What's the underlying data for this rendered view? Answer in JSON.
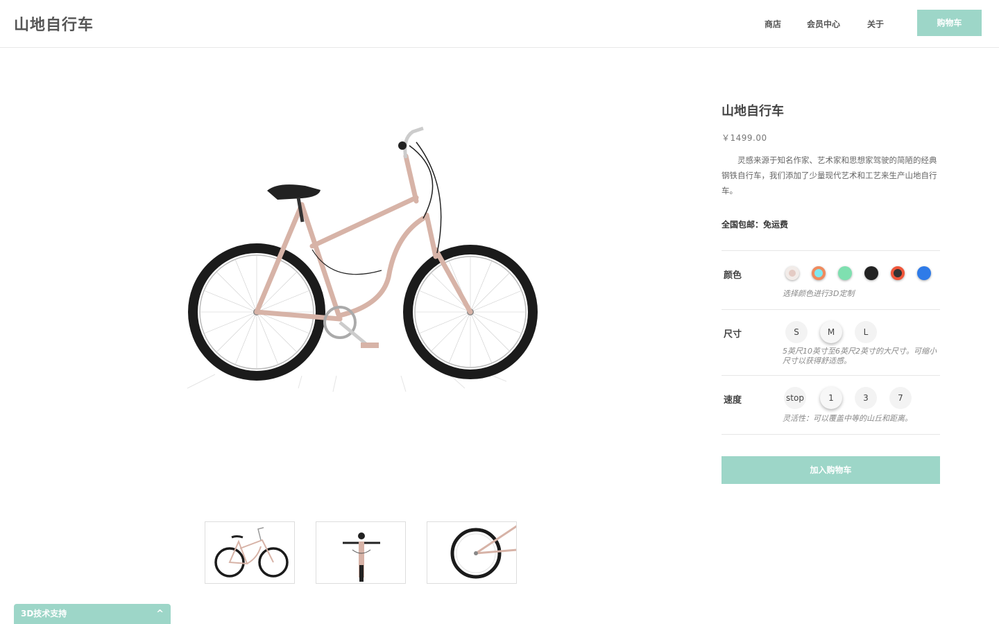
{
  "header": {
    "logo": "山地自行车",
    "nav": [
      "商店",
      "会员中心",
      "关于"
    ],
    "cart_label": "购物车"
  },
  "product": {
    "title": "山地自行车",
    "price": "￥1499.00",
    "description": "灵感来源于知名作家、艺术家和思想家驾驶的简陋的经典钢铁自行车，我们添加了少量现代艺术和工艺来生产山地自行车。",
    "shipping": "全国包邮：免运费"
  },
  "options": {
    "color": {
      "label": "颜色",
      "note": "选择颜色进行3D定制",
      "swatches": [
        {
          "name": "rose-gold",
          "color": "#e4cbc4"
        },
        {
          "name": "coral-ring",
          "color": "#f08a5d"
        },
        {
          "name": "mint",
          "color": "#7fe0b0"
        },
        {
          "name": "black",
          "color": "#222222"
        },
        {
          "name": "red-orange",
          "color": "#f0563a"
        },
        {
          "name": "blue",
          "color": "#2f7be8"
        }
      ],
      "selected": "rose-gold"
    },
    "size": {
      "label": "尺寸",
      "note": "5英尺10英寸至6英尺2英寸的大尺寸。可缩小尺寸以获得舒适感。",
      "values": [
        "S",
        "M",
        "L"
      ],
      "selected": "M"
    },
    "speed": {
      "label": "速度",
      "note": "灵活性：可以覆盖中等的山丘和距离。",
      "values": [
        "stop",
        "1",
        "3",
        "7"
      ],
      "selected": "1"
    }
  },
  "add_to_cart_label": "加入购物车",
  "support_label": "3D技术支持",
  "support_chevron": "^",
  "colors": {
    "accent": "#9dd6c8",
    "frame": "#d7b3a7"
  }
}
